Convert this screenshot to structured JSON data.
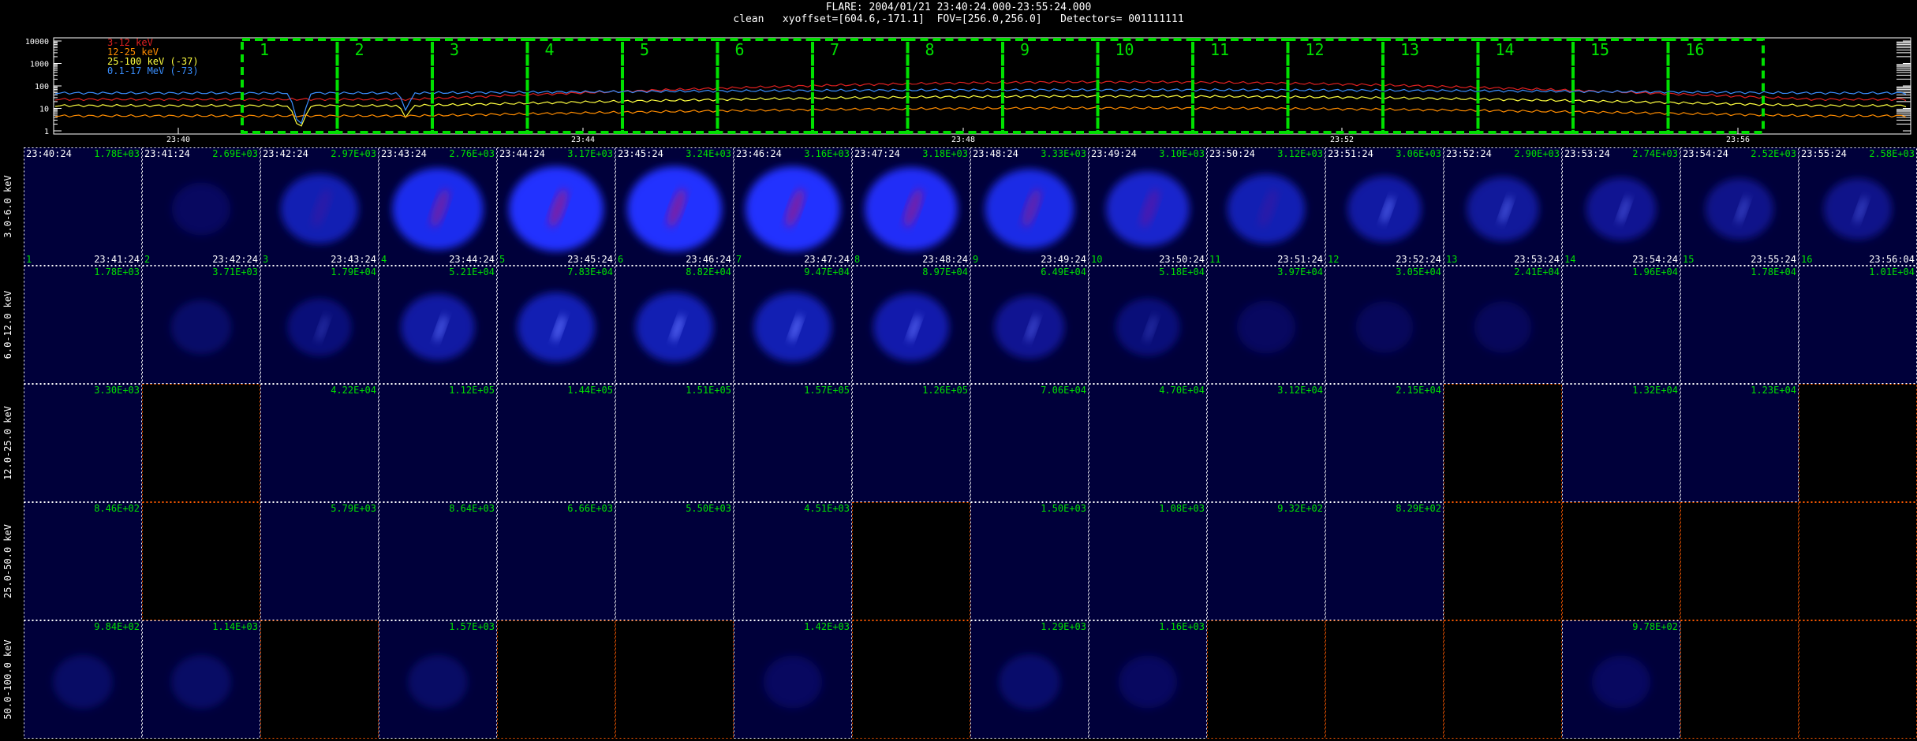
{
  "header": {
    "line1": "FLARE: 2004/01/21 23:40:24.000-23:55:24.000",
    "line2": "clean   xyoffset=[604.6,-171.1]  FOV=[256.0,256.0]   Detectors= 001111111"
  },
  "lightcurve": {
    "y_ticks": [
      "10000",
      "1000",
      "100",
      "10",
      "1"
    ],
    "x_ticks": [
      "23:40",
      "23:44",
      "23:48",
      "23:52",
      "23:56"
    ],
    "legend": [
      {
        "label": "3-12 keV",
        "color": "#e02020"
      },
      {
        "label": "12-25 keV",
        "color": "#ff8c00"
      },
      {
        "label": "25-100 keV (-37)",
        "color": "#ffff40"
      },
      {
        "label": "0.1-17 MeV (-73)",
        "color": "#3a8fff"
      }
    ],
    "intervals": [
      "1",
      "2",
      "3",
      "4",
      "5",
      "6",
      "7",
      "8",
      "9",
      "10",
      "11",
      "12",
      "13",
      "14",
      "15",
      "16"
    ],
    "interval_color": "#00e000",
    "y_scale": "log"
  },
  "grid": {
    "energy_bands": [
      "3.0-6.0 keV",
      "6.0-12.0 keV",
      "12.0-25.0 keV",
      "25.0-50.0 keV",
      "50.0-100.0 keV"
    ],
    "start_times": [
      "23:40:24",
      "23:41:24",
      "23:42:24",
      "23:43:24",
      "23:44:24",
      "23:45:24",
      "23:46:24",
      "23:47:24",
      "23:48:24",
      "23:49:24",
      "23:50:24",
      "23:51:24",
      "23:52:24",
      "23:53:24",
      "23:54:24",
      "23:55:24"
    ],
    "end_times": [
      "23:41:24",
      "23:42:24",
      "23:43:24",
      "23:44:24",
      "23:45:24",
      "23:46:24",
      "23:47:24",
      "23:48:24",
      "23:49:24",
      "23:50:24",
      "23:51:24",
      "23:52:24",
      "23:53:24",
      "23:54:24",
      "23:55:24",
      "23:56:04"
    ],
    "max_values": [
      [
        "1.78E+03",
        "2.69E+03",
        "2.97E+03",
        "2.76E+03",
        "3.17E+03",
        "3.24E+03",
        "3.16E+03",
        "3.18E+03",
        "3.33E+03",
        "3.10E+03",
        "3.12E+03",
        "3.06E+03",
        "2.90E+03",
        "2.74E+03",
        "2.52E+03",
        "2.58E+03"
      ],
      [
        "1.78E+03",
        "3.71E+03",
        "1.79E+04",
        "5.21E+04",
        "7.83E+04",
        "8.82E+04",
        "9.47E+04",
        "8.97E+04",
        "6.49E+04",
        "5.18E+04",
        "3.97E+04",
        "3.05E+04",
        "2.41E+04",
        "1.96E+04",
        "1.78E+04",
        "1.01E+04"
      ],
      [
        "3.30E+03",
        "",
        "4.22E+04",
        "1.12E+05",
        "1.44E+05",
        "1.51E+05",
        "1.57E+05",
        "1.26E+05",
        "7.06E+04",
        "4.70E+04",
        "3.12E+04",
        "2.15E+04",
        "",
        "1.32E+04",
        "1.23E+04",
        ""
      ],
      [
        "8.46E+02",
        "",
        "5.79E+03",
        "8.64E+03",
        "6.66E+03",
        "5.50E+03",
        "4.51E+03",
        "",
        "1.50E+03",
        "1.08E+03",
        "9.32E+02",
        "8.29E+02",
        "",
        "",
        "",
        ""
      ],
      [
        "9.84E+02",
        "1.14E+03",
        "",
        "1.57E+03",
        "",
        "",
        "1.42E+03",
        "",
        "1.29E+03",
        "1.16E+03",
        "",
        "",
        "",
        "9.78E+02",
        "",
        ""
      ]
    ],
    "intensity": [
      [
        0.0,
        0.05,
        0.55,
        0.9,
        1.0,
        1.0,
        1.0,
        0.95,
        0.85,
        0.7,
        0.55,
        0.45,
        0.4,
        0.35,
        0.3,
        0.3
      ],
      [
        0.0,
        0.1,
        0.2,
        0.45,
        0.55,
        0.55,
        0.55,
        0.5,
        0.35,
        0.2,
        0.05,
        0.02,
        0.02,
        0.0,
        0.0,
        0.0
      ],
      [
        0.0,
        0.0,
        0.0,
        0.0,
        0.0,
        0.0,
        0.0,
        0.0,
        0.0,
        0.0,
        0.0,
        0.0,
        0.0,
        0.0,
        0.0,
        0.0
      ],
      [
        0.0,
        0.0,
        0.0,
        0.0,
        0.0,
        0.0,
        0.0,
        0.0,
        0.0,
        0.0,
        0.0,
        0.0,
        0.0,
        0.0,
        0.0,
        0.0
      ],
      [
        0.08,
        0.08,
        0.0,
        0.08,
        0.0,
        0.0,
        0.05,
        0.0,
        0.12,
        0.05,
        0.0,
        0.0,
        0.0,
        0.05,
        0.0,
        0.0
      ]
    ],
    "empty_cells": [
      [
        false,
        false,
        false,
        false,
        false,
        false,
        false,
        false,
        false,
        false,
        false,
        false,
        false,
        false,
        false,
        false
      ],
      [
        false,
        false,
        false,
        false,
        false,
        false,
        false,
        false,
        false,
        false,
        false,
        false,
        false,
        false,
        false,
        false
      ],
      [
        false,
        true,
        false,
        false,
        false,
        false,
        false,
        false,
        false,
        false,
        false,
        false,
        true,
        false,
        false,
        true
      ],
      [
        false,
        true,
        false,
        false,
        false,
        false,
        false,
        true,
        false,
        false,
        false,
        false,
        true,
        true,
        true,
        true
      ],
      [
        false,
        false,
        true,
        false,
        true,
        true,
        false,
        true,
        false,
        false,
        true,
        true,
        true,
        false,
        true,
        true
      ]
    ],
    "colors": {
      "time_label": "#ffffff",
      "value_label": "#00e000",
      "image_bg": "#00003a",
      "flare_core": "#b01070",
      "empty_axis": "#ff5a00"
    }
  }
}
